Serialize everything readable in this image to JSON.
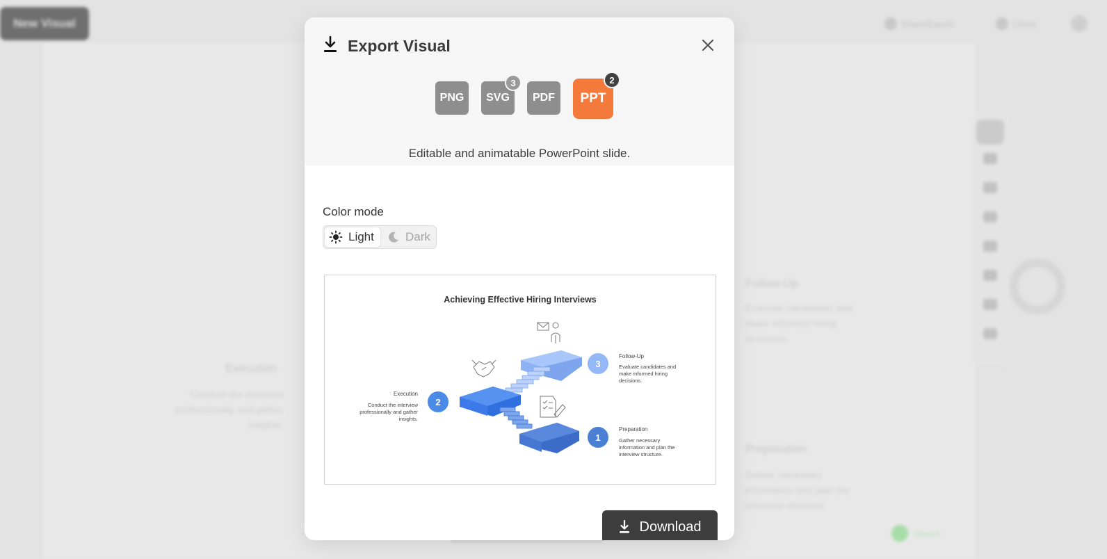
{
  "background": {
    "top_left_button": "New Visual",
    "share_label": "Share/Export",
    "user_label": "Users",
    "right_heading_top": "Follow-Up",
    "right_text_top": [
      "Evaluate candidates and",
      "make informed hiring",
      "decisions."
    ],
    "right_heading_bottom": "Preparation",
    "right_text_bottom": [
      "Gather necessary",
      "information and plan the",
      "interview structure."
    ],
    "left_heading": "Execution",
    "left_text": [
      "Conduct the interview",
      "professionally and gather",
      "insights."
    ],
    "status_label": "Saved"
  },
  "modal": {
    "title": "Export Visual",
    "icons": {
      "title": "download-icon",
      "close": "close-icon"
    },
    "formats": [
      {
        "label": "PNG",
        "badge": "",
        "active": false
      },
      {
        "label": "SVG",
        "badge": "3",
        "active": false
      },
      {
        "label": "PDF",
        "badge": "",
        "active": false
      },
      {
        "label": "PPT",
        "badge": "2",
        "active": true
      }
    ],
    "format_description": "Editable and animatable PowerPoint slide.",
    "color_mode": {
      "label": "Color mode",
      "options": [
        {
          "label": "Light",
          "icon": "sun-icon",
          "selected": true
        },
        {
          "label": "Dark",
          "icon": "moon-icon",
          "selected": false
        }
      ]
    },
    "preview": {
      "title": "Achieving Effective Hiring Interviews",
      "steps": [
        {
          "number": "1",
          "name": "Preparation",
          "description": [
            "Gather necessary",
            "information and plan the",
            "interview structure."
          ]
        },
        {
          "number": "2",
          "name": "Execution",
          "description": [
            "Conduct the interview",
            "professionally and gather",
            "insights."
          ]
        },
        {
          "number": "3",
          "name": "Follow-Up",
          "description": [
            "Evaluate candidates and",
            "make informed hiring",
            "decisions."
          ]
        }
      ],
      "colors": {
        "step1": "#4a7fd4",
        "step2": "#4a8be8",
        "step3": "#94b8f7"
      }
    },
    "download_label": "Download"
  }
}
